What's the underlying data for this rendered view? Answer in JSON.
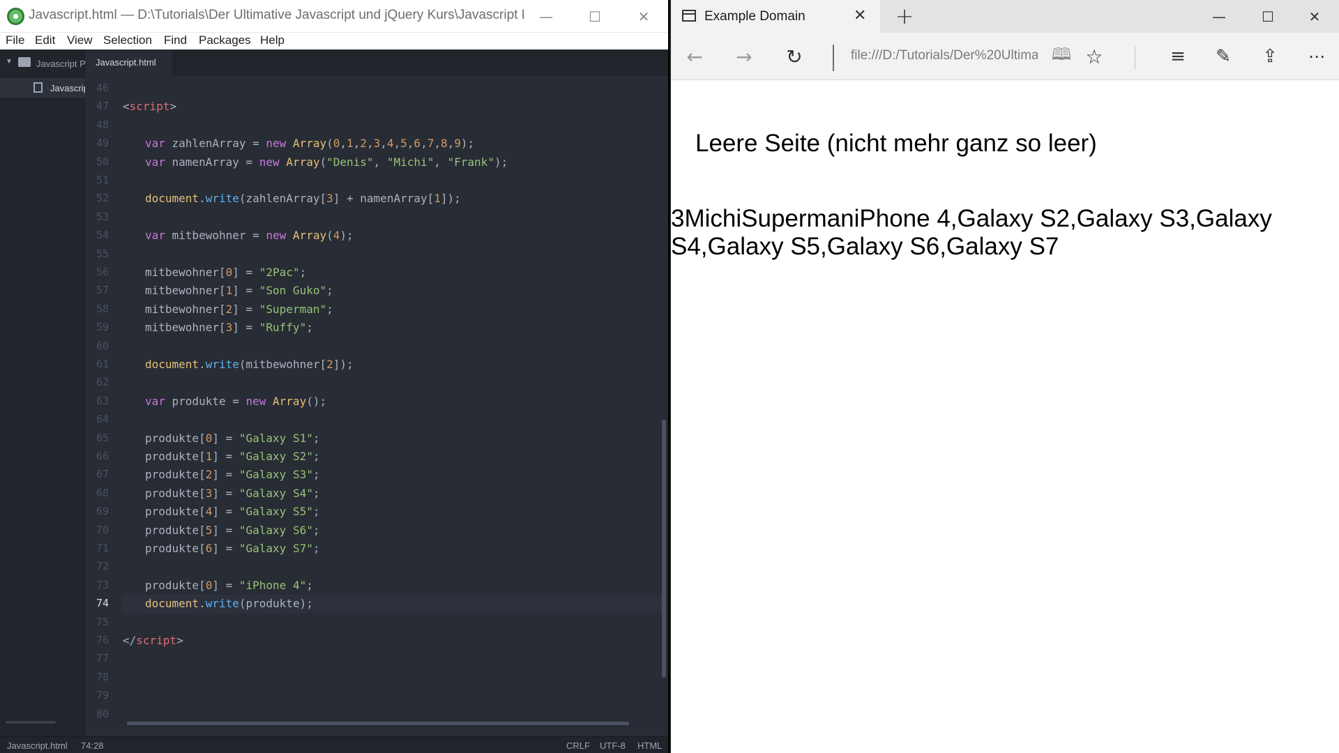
{
  "atom": {
    "title": "Javascript.html — D:\\Tutorials\\Der Ultimative Javascript und jQuery Kurs\\Javascript Proj...",
    "menu": [
      "File",
      "Edit",
      "View",
      "Selection",
      "Find",
      "Packages",
      "Help"
    ],
    "tree": {
      "root_label": "Javascript P",
      "file_label": "Javascrip"
    },
    "tab_label": "Javascript.html",
    "line_numbers": [
      "46",
      "47",
      "48",
      "49",
      "50",
      "51",
      "52",
      "53",
      "54",
      "55",
      "56",
      "57",
      "58",
      "59",
      "60",
      "61",
      "62",
      "63",
      "64",
      "65",
      "66",
      "67",
      "68",
      "69",
      "70",
      "71",
      "72",
      "73",
      "74",
      "75",
      "76",
      "77",
      "78",
      "79",
      "80"
    ],
    "current_line": "74",
    "status": {
      "file": "Javascript.html",
      "position": "74:28",
      "line_ending": "CRLF",
      "encoding": "UTF-8",
      "grammar": "HTML"
    }
  },
  "code": {
    "l47": [
      "<",
      "script",
      ">"
    ],
    "l49": [
      "var",
      "zahlenArray",
      "=",
      "new",
      "Array",
      "(",
      "0",
      ",",
      "1",
      ",",
      "2",
      ",",
      "3",
      ",",
      "4",
      ",",
      "5",
      ",",
      "6",
      ",",
      "7",
      ",",
      "8",
      ",",
      "9",
      ");"
    ],
    "l50": [
      "var",
      "namenArray",
      "=",
      "new",
      "Array",
      "(",
      "\"Denis\"",
      ", ",
      "\"Michi\"",
      ", ",
      "\"Frank\"",
      ");"
    ],
    "l52": [
      "document",
      ".",
      "write",
      "(zahlenArray[",
      "3",
      "] + namenArray[",
      "1",
      "]);"
    ],
    "l54": [
      "var",
      "mitbewohner",
      "=",
      "new",
      "Array",
      "(",
      "4",
      ");"
    ],
    "l56": [
      "mitbewohner[",
      "0",
      "] = ",
      "\"2Pac\"",
      ";"
    ],
    "l57": [
      "mitbewohner[",
      "1",
      "] = ",
      "\"Son Guko\"",
      ";"
    ],
    "l58": [
      "mitbewohner[",
      "2",
      "] = ",
      "\"Superman\"",
      ";"
    ],
    "l59": [
      "mitbewohner[",
      "3",
      "] = ",
      "\"Ruffy\"",
      ";"
    ],
    "l61": [
      "document",
      ".",
      "write",
      "(mitbewohner[",
      "2",
      "]);"
    ],
    "l63": [
      "var",
      "produkte",
      "=",
      "new",
      "Array",
      "();"
    ],
    "l65": [
      "produkte[",
      "0",
      "] = ",
      "\"Galaxy S1\"",
      ";"
    ],
    "l66": [
      "produkte[",
      "1",
      "] = ",
      "\"Galaxy S2\"",
      ";"
    ],
    "l67": [
      "produkte[",
      "2",
      "] = ",
      "\"Galaxy S3\"",
      ";"
    ],
    "l68": [
      "produkte[",
      "3",
      "] = ",
      "\"Galaxy S4\"",
      ";"
    ],
    "l69": [
      "produkte[",
      "4",
      "] = ",
      "\"Galaxy S5\"",
      ";"
    ],
    "l70": [
      "produkte[",
      "5",
      "] = ",
      "\"Galaxy S6\"",
      ";"
    ],
    "l71": [
      "produkte[",
      "6",
      "] = ",
      "\"Galaxy S7\"",
      ";"
    ],
    "l73": [
      "produkte[",
      "0",
      "] = ",
      "\"iPhone 4\"",
      ";"
    ],
    "l74": [
      "document",
      ".",
      "write",
      "(produkte);"
    ],
    "l76": [
      "</",
      "script",
      ">"
    ]
  },
  "edge": {
    "tab_title": "Example Domain",
    "url": "file:///D:/Tutorials/Der%20Ultima",
    "page_heading": "Leere Seite (nicht mehr ganz so leer)",
    "page_output": "3MichiSupermaniPhone 4,Galaxy S2,Galaxy S3,Galaxy S4,Galaxy S5,Galaxy S6,Galaxy S7"
  },
  "icons": {
    "atom_logo": "atom-logo-icon",
    "minimize": "minimize-icon",
    "maximize": "maximize-icon",
    "close": "close-icon",
    "back": "back-arrow-icon",
    "forward": "forward-arrow-icon",
    "refresh": "refresh-icon",
    "reading_view": "reading-view-icon",
    "favorite": "star-icon",
    "hub": "hub-icon",
    "web_note": "web-note-icon",
    "share": "share-icon",
    "more": "more-icon"
  }
}
